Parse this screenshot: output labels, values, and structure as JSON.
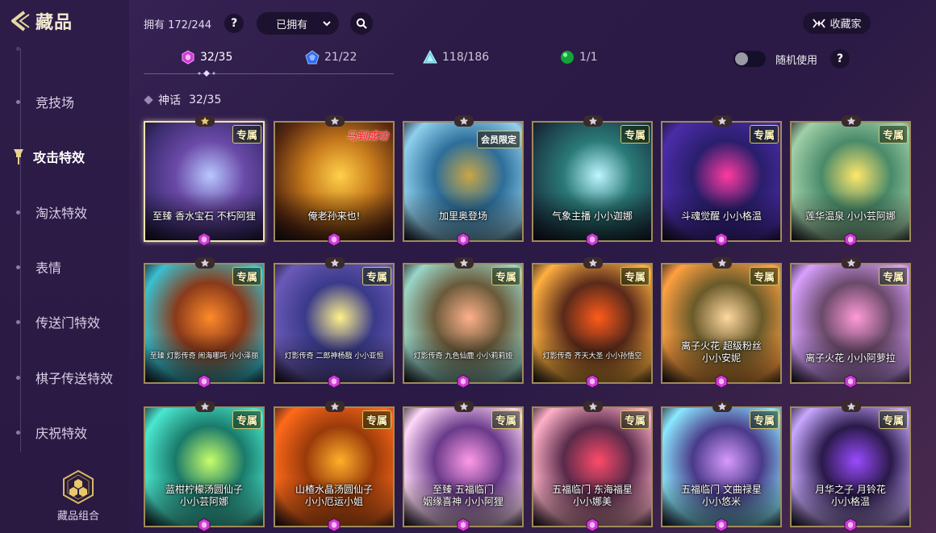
{
  "header": {
    "back_title": "藏品"
  },
  "sidebar": {
    "items": [
      {
        "label": "竞技场"
      },
      {
        "label": "攻击特效"
      },
      {
        "label": "淘汰特效"
      },
      {
        "label": "表情"
      },
      {
        "label": "传送门特效"
      },
      {
        "label": "棋子传送特效"
      },
      {
        "label": "庆祝特效"
      }
    ],
    "combo_label": "藏品组合"
  },
  "toolbar": {
    "owned_text": "拥有 172/244",
    "help_label": "?",
    "filter_value": "已拥有",
    "collector_label": "收藏家"
  },
  "tabs": [
    {
      "count": "32/35",
      "icon": "purple-gem-icon"
    },
    {
      "count": "21/22",
      "icon": "blue-gem-icon"
    },
    {
      "count": "118/186",
      "icon": "teal-triangle-icon"
    },
    {
      "count": "1/1",
      "icon": "green-orb-icon"
    }
  ],
  "random_toggle": {
    "label": "随机使用",
    "on": false,
    "help_label": "?"
  },
  "section": {
    "title": "神话",
    "count": "32/35"
  },
  "cards": [
    {
      "name": "至臻 香水宝石 不朽阿狸",
      "badge": "专属"
    },
    {
      "name": "俺老孙来也!",
      "badge": "",
      "promo_text": "马到成功"
    },
    {
      "name": "加里奥登场",
      "badge": "会员限定"
    },
    {
      "name": "气象主播 小小迦娜",
      "badge": "专属"
    },
    {
      "name": "斗魂觉醒 小小格温",
      "badge": "专属"
    },
    {
      "name": "莲华温泉 小小芸阿娜",
      "badge": "专属"
    },
    {
      "name": "至臻 灯影传奇 闹海哪吒 小小泽丽",
      "badge": "专属"
    },
    {
      "name": "灯影传奇 二郎神杨戬 小小亚恒",
      "badge": "专属"
    },
    {
      "name": "灯影传奇 九色仙鹿 小小莉莉娅",
      "badge": "专属"
    },
    {
      "name": "灯影传奇 齐天大圣 小小孙悟空",
      "badge": "专属"
    },
    {
      "name": "离子火花 超级粉丝\n小小安妮",
      "badge": "专属"
    },
    {
      "name": "离子火花 小小阿萝拉",
      "badge": "专属"
    },
    {
      "name": "蓝柑柠檬汤圆仙子\n小小芸阿娜",
      "badge": "专属"
    },
    {
      "name": "山楂水晶汤圆仙子\n小小厄运小姐",
      "badge": "专属"
    },
    {
      "name": "至臻 五福临门\n姻缘喜神 小小阿狸",
      "badge": "专属"
    },
    {
      "name": "五福临门 东海福星\n小小娜美",
      "badge": "专属"
    },
    {
      "name": "五福临门 文曲禄星\n小小悠米",
      "badge": "专属"
    },
    {
      "name": "月华之子 月铃花\n小小格温",
      "badge": "专属"
    }
  ],
  "colors": {
    "accent_gold": "#c9a85c",
    "mythic_purple": "#d23ad8",
    "background": "#2c1b46"
  }
}
